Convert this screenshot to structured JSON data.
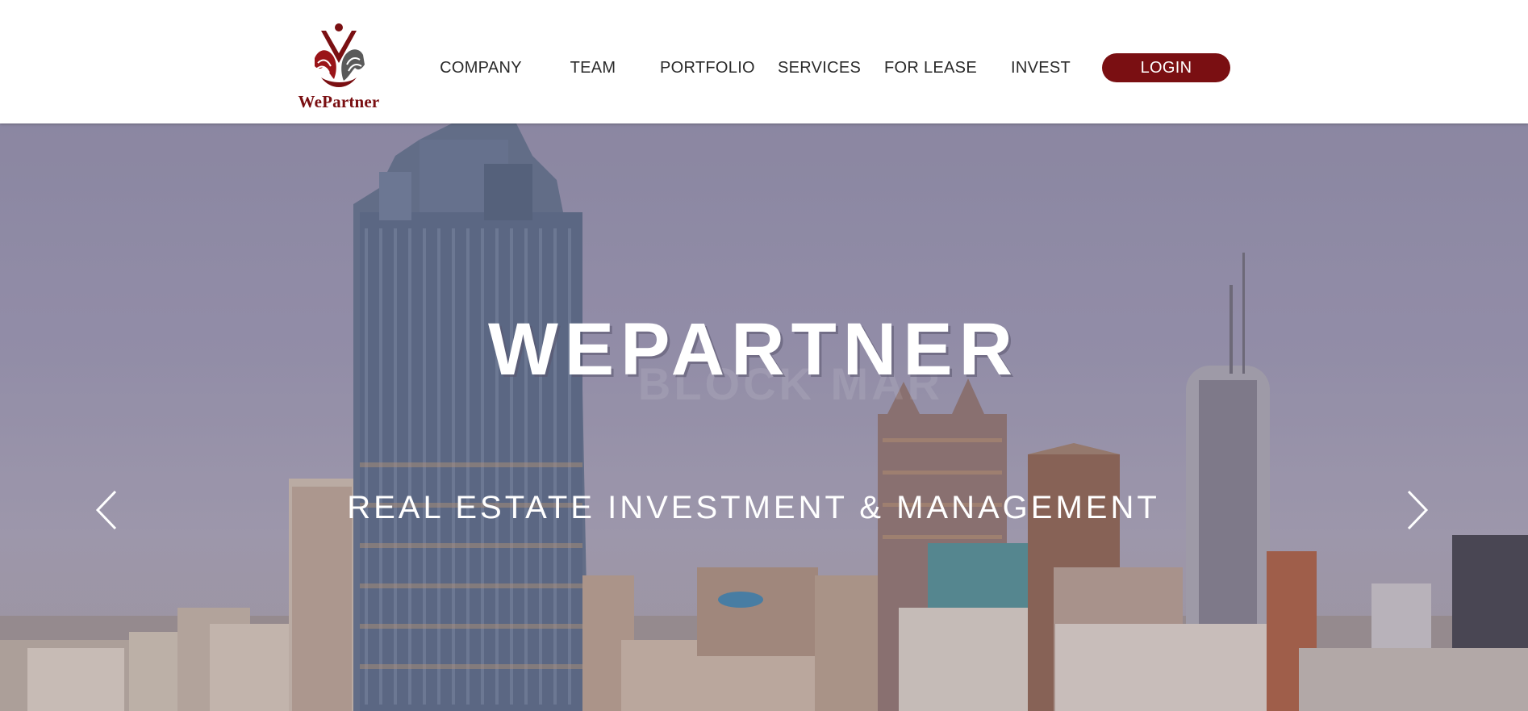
{
  "brand": {
    "name": "WePartner",
    "accent_color": "#7a0f12",
    "logo_icon": "wepartner-hands-logo"
  },
  "nav": {
    "items": [
      {
        "label": "COMPANY"
      },
      {
        "label": "TEAM"
      },
      {
        "label": "PORTFOLIO"
      },
      {
        "label": "SERVICES"
      },
      {
        "label": "FOR LEASE"
      },
      {
        "label": "INVEST"
      }
    ],
    "login_label": "LOGIN"
  },
  "hero": {
    "title": "WEPARTNER",
    "subtitle": "REAL ESTATE INVESTMENT & MANAGEMENT",
    "background_ghost_text": "BLOCK MAR",
    "prev_icon": "chevron-left-icon",
    "next_icon": "chevron-right-icon"
  }
}
